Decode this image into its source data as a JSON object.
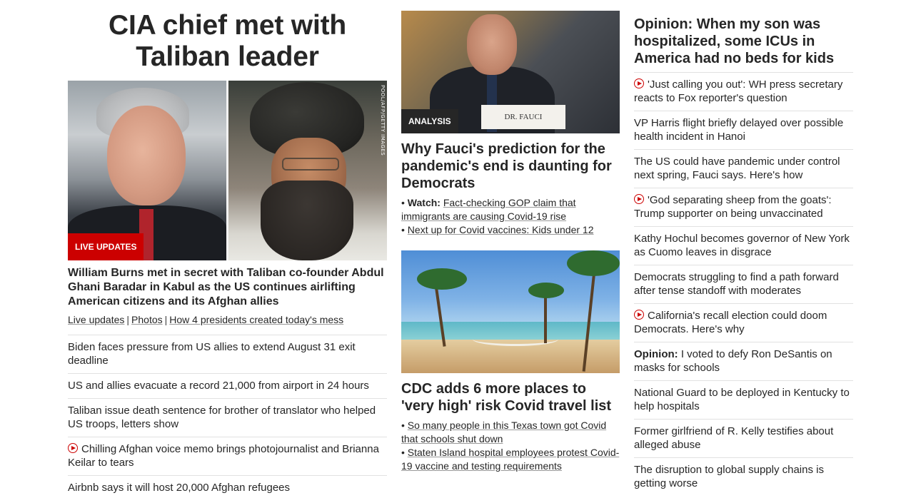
{
  "col1": {
    "headline": "CIA chief met with Taliban leader",
    "photo_credit": "POOL/AFP/GETTY IMAGES",
    "badge": "LIVE UPDATES",
    "lede": "William Burns met in secret with Taliban co-founder Abdul Ghani Baradar in Kabul as the US continues airlifting American citizens and its Afghan allies",
    "sublinks": [
      "Live updates",
      "Photos",
      "How 4 presidents created today's mess"
    ],
    "sublink_sep": "|",
    "items": [
      {
        "text": "Biden faces pressure from US allies to extend August 31 exit deadline",
        "video": false
      },
      {
        "text": "US and allies evacuate a record 21,000 from airport in 24 hours",
        "video": false
      },
      {
        "text": "Taliban issue death sentence for brother of translator who helped US troops, letters show",
        "video": false
      },
      {
        "text": "Chilling Afghan voice memo brings photojournalist and Brianna Keilar to tears",
        "video": true
      },
      {
        "text": "Airbnb says it will host 20,000 Afghan refugees",
        "video": false
      }
    ]
  },
  "col2": {
    "card1": {
      "badge": "ANALYSIS",
      "nameplate": "DR. FAUCI",
      "headline": "Why Fauci's prediction for the pandemic's end is daunting for Democrats",
      "bullet1_prefix": "Watch:",
      "bullet1": "Fact-checking GOP claim that immigrants are causing Covid-19 rise",
      "bullet2": "Next up for Covid vaccines: Kids under 12"
    },
    "card2": {
      "headline": "CDC adds 6 more places to 'very high' risk Covid travel list",
      "bullet1": "So many people in this Texas town got Covid that schools shut down",
      "bullet2": "Staten Island hospital employees protest Covid-19 vaccine and testing requirements"
    },
    "bullet_marker": "•"
  },
  "col3": {
    "headline": "Opinion: When my son was hospitalized, some ICUs in America had no beds for kids",
    "items": [
      {
        "prefix": "",
        "text": "'Just calling you out': WH press secretary reacts to Fox reporter's question",
        "video": true
      },
      {
        "prefix": "",
        "text": "VP Harris flight briefly delayed over possible health incident in Hanoi",
        "video": false
      },
      {
        "prefix": "",
        "text": "The US could have pandemic under control next spring, Fauci says. Here's how",
        "video": false
      },
      {
        "prefix": "",
        "text": "'God separating sheep from the goats': Trump supporter on being unvaccinated",
        "video": true
      },
      {
        "prefix": "",
        "text": "Kathy Hochul becomes governor of New York as Cuomo leaves in disgrace",
        "video": false
      },
      {
        "prefix": "",
        "text": "Democrats struggling to find a path forward after tense standoff with moderates",
        "video": false
      },
      {
        "prefix": "",
        "text": "California's recall election could doom Democrats. Here's why",
        "video": true
      },
      {
        "prefix": "Opinion:",
        "text": "I voted to defy Ron DeSantis on masks for schools",
        "video": false
      },
      {
        "prefix": "",
        "text": "National Guard to be deployed in Kentucky to help hospitals",
        "video": false
      },
      {
        "prefix": "",
        "text": "Former girlfriend of R. Kelly testifies about alleged abuse",
        "video": false
      },
      {
        "prefix": "",
        "text": "The disruption to global supply chains is getting worse",
        "video": false
      }
    ]
  },
  "colors": {
    "accent_red": "#cc0000",
    "text": "#262626",
    "divider": "#e1e1e1"
  }
}
